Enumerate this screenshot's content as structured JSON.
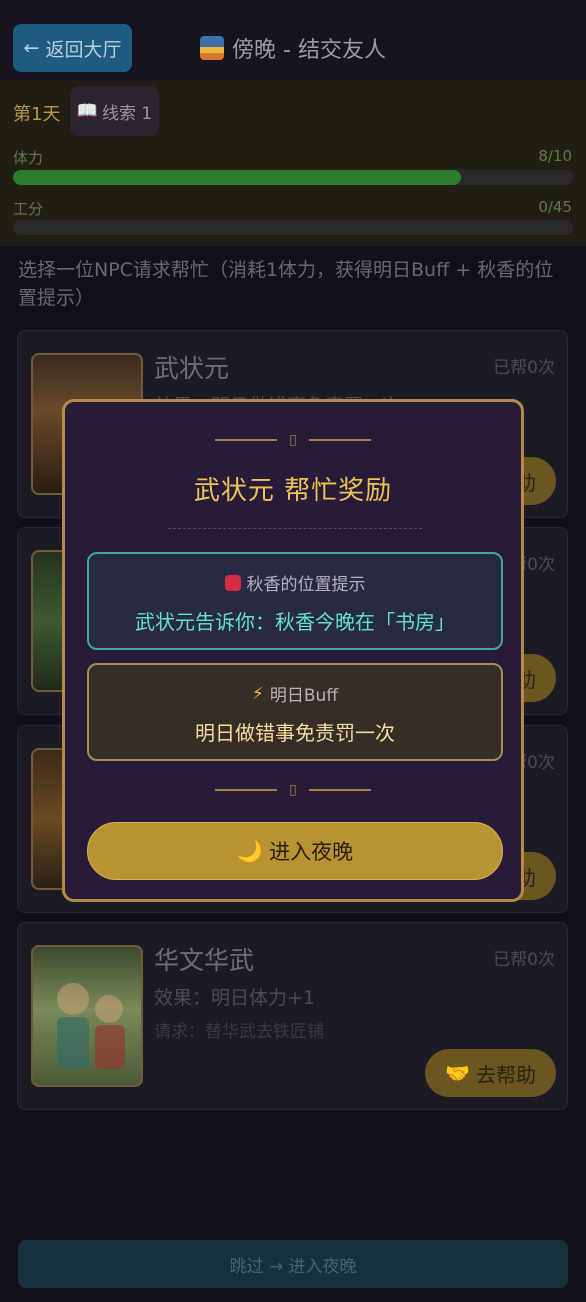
{
  "header": {
    "back_label": "返回大厅",
    "title": "傍晚 - 结交友人"
  },
  "status": {
    "day": "第1天",
    "clue": "线索 1",
    "stamina_label": "体力",
    "stamina_value": "8/10",
    "stamina_fraction": 0.8,
    "work_label": "工分",
    "work_value": "0/45",
    "work_fraction": 0
  },
  "instruction": "选择一位NPC请求帮忙（消耗1体力，获得明日Buff + 秋香的位置提示）",
  "npcs": [
    {
      "name": "武状元",
      "count": "已帮0次",
      "effect": "效果：明日做错事免责罚一次",
      "request": "",
      "button": "去帮助"
    },
    {
      "name": "",
      "count": "已帮0次",
      "effect": "",
      "request": "",
      "button": "去帮助"
    },
    {
      "name": "",
      "count": "已帮0次",
      "effect": "",
      "request": "",
      "button": "去帮助"
    },
    {
      "name": "华文华武",
      "count": "已帮0次",
      "effect": "效果：明日体力+1",
      "request": "请求：替华武去铁匠铺",
      "button": "去帮助"
    }
  ],
  "skip_label": "跳过 → 进入夜晚",
  "modal": {
    "title": "武状元 帮忙奖励",
    "hint_label": "秋香的位置提示",
    "hint_text": "武状元告诉你：秋香今晚在「书房」",
    "buff_label": "明日Buff",
    "buff_text": "明日做错事免责罚一次",
    "enter_label": "进入夜晚",
    "ornament_glyph": "▯"
  },
  "colors": {
    "accent_gold": "#f0c453",
    "hint_teal": "#62e2d0",
    "modal_bg": "#281b3a",
    "stamina_bar": "#2e7d2e"
  }
}
